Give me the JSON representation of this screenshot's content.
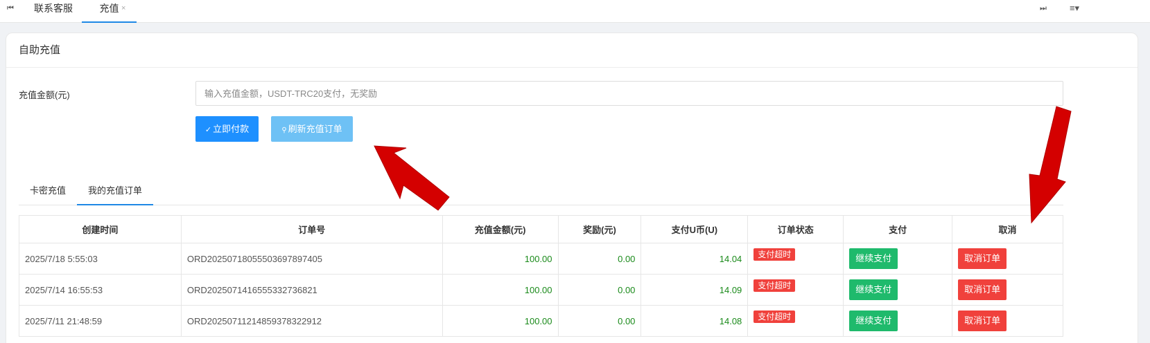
{
  "tabbar": {
    "first_icon": "⏮",
    "tabs": [
      {
        "label": "联系客服",
        "active": false
      },
      {
        "label": "充值",
        "active": true,
        "close": "×"
      }
    ],
    "last_icon": "⏭",
    "menu_icon": "≡▾"
  },
  "card": {
    "title": "自助充值",
    "amount_label": "充值金额(元)",
    "amount_placeholder": "输入充值金额，USDT-TRC20支付，无奖励",
    "pay_button": "立即付款",
    "pay_icon": "✓",
    "refresh_button": "刷新充值订单",
    "refresh_icon": "🔍"
  },
  "subtabs": [
    {
      "label": "卡密充值",
      "active": false
    },
    {
      "label": "我的充值订单",
      "active": true
    }
  ],
  "table": {
    "headers": [
      "创建时间",
      "订单号",
      "充值金额(元)",
      "奖励(元)",
      "支付U币(U)",
      "订单状态",
      "支付",
      "取消"
    ],
    "rows": [
      {
        "time": "2025/7/18 5:55:03",
        "order": "ORD20250718055503697897405",
        "amount": "100.00",
        "bonus": "0.00",
        "usdt": "14.04",
        "status": "支付超时",
        "pay": "继续支付",
        "cancel": "取消订单"
      },
      {
        "time": "2025/7/14 16:55:53",
        "order": "ORD20250714165553327368​21",
        "amount": "100.00",
        "bonus": "0.00",
        "usdt": "14.09",
        "status": "支付超时",
        "pay": "继续支付",
        "cancel": "取消订单"
      },
      {
        "time": "2025/7/11 21:48:59",
        "order": "ORD20250711214859378322912",
        "amount": "100.00",
        "bonus": "0.00",
        "usdt": "14.08",
        "status": "支付超时",
        "pay": "继续支付",
        "cancel": "取消订单"
      }
    ]
  },
  "colors": {
    "primary": "#1e90ff",
    "primary_light": "#6ec1f5",
    "success": "#1fba6c",
    "danger": "#f0413c",
    "amount_text": "#1a8a1a",
    "annotation_arrow": "#d40000"
  }
}
